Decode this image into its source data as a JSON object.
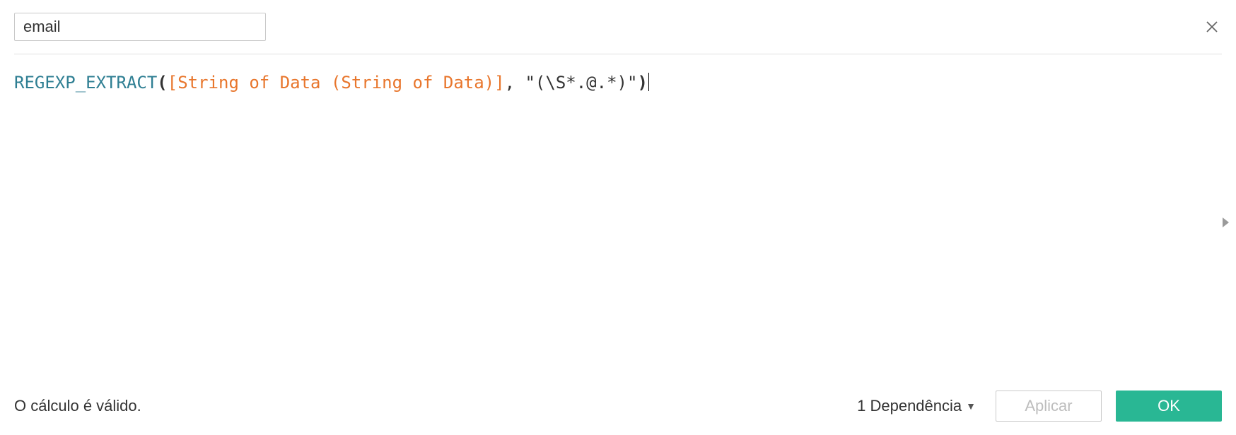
{
  "header": {
    "name_value": "email"
  },
  "formula": {
    "function": "REGEXP_EXTRACT",
    "open_paren": "(",
    "field": "[String of Data (String of Data)]",
    "separator": ", ",
    "string_literal": "\"(\\S*.@.*)\"",
    "close_paren": ")"
  },
  "footer": {
    "status": "O cálculo é válido.",
    "dependencies_label": "1 Dependência",
    "apply_label": "Aplicar",
    "ok_label": "OK"
  }
}
